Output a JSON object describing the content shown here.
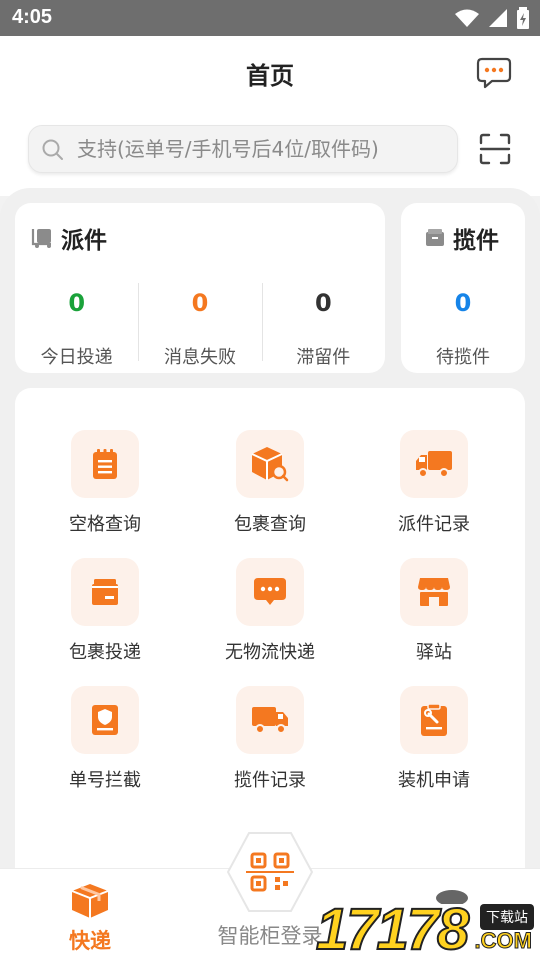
{
  "status_bar": {
    "time": "4:05"
  },
  "header": {
    "title": "首页"
  },
  "search": {
    "placeholder": "支持(运单号/手机号后4位/取件码)"
  },
  "pai_card": {
    "title": "派件",
    "stats": [
      {
        "value": "0",
        "label": "今日投递",
        "color": "#1aa23a"
      },
      {
        "value": "0",
        "label": "消息失败",
        "color": "#f47820"
      },
      {
        "value": "0",
        "label": "滞留件",
        "color": "#333333"
      }
    ]
  },
  "lan_card": {
    "title": "揽件",
    "stats": [
      {
        "value": "0",
        "label": "待揽件",
        "color": "#1684e8"
      }
    ]
  },
  "grid": [
    {
      "label": "空格查询",
      "icon": "notepad-icon"
    },
    {
      "label": "包裹查询",
      "icon": "package-search-icon"
    },
    {
      "label": "派件记录",
      "icon": "delivery-truck-icon"
    },
    {
      "label": "包裹投递",
      "icon": "box-icon"
    },
    {
      "label": "无物流快递",
      "icon": "chat-bubble-icon"
    },
    {
      "label": "驿站",
      "icon": "store-icon"
    },
    {
      "label": "单号拦截",
      "icon": "shield-doc-icon"
    },
    {
      "label": "揽件记录",
      "icon": "truck-icon"
    },
    {
      "label": "装机申请",
      "icon": "wrench-doc-icon"
    }
  ],
  "bottom_nav": {
    "kuaidi": "快递",
    "smart_cabinet": "智能柜登录"
  },
  "watermark": {
    "number": "17178",
    "tag": "下载站",
    "domain": ".COM"
  },
  "colors": {
    "accent": "#f47820",
    "icon_bg": "#fdf1ea"
  }
}
